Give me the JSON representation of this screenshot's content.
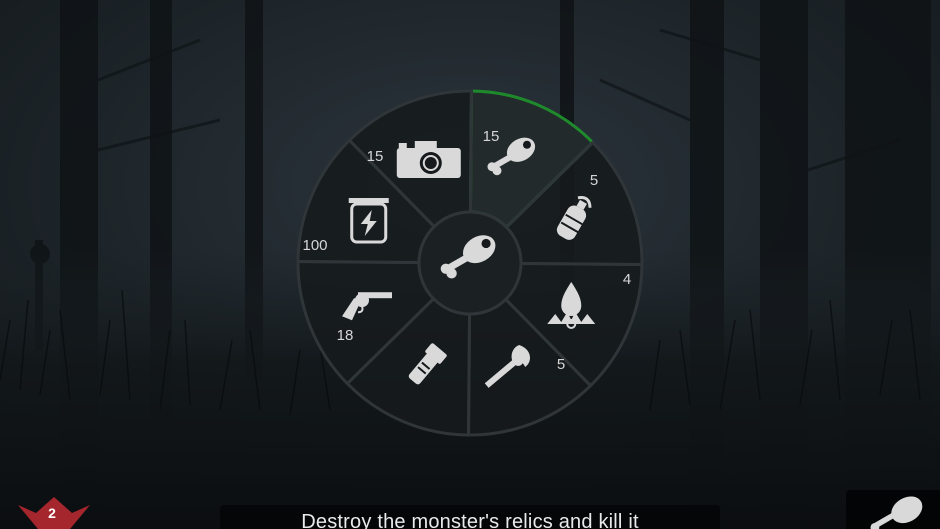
{
  "colors": {
    "sky": "#1f272d",
    "fog": "#2c363d",
    "wheel_bg": "#161a1c",
    "divider": "#2f3538",
    "selected_outline": "#1f8a2c",
    "icon": "#d9d9d9",
    "relic_red": "#a5262c"
  },
  "wheel": {
    "selected_item": "meat",
    "center_icon": "meat-icon",
    "segments": [
      {
        "item": "meat",
        "icon": "meat-icon",
        "count": "15",
        "selected": true
      },
      {
        "item": "fuel-canister",
        "icon": "fuel-canister-icon",
        "count": "5",
        "selected": false
      },
      {
        "item": "trap",
        "icon": "trap-icon",
        "count": "4",
        "selected": false
      },
      {
        "item": "torch",
        "icon": "torch-icon",
        "count": "5",
        "selected": false
      },
      {
        "item": "flashlight",
        "icon": "flashlight-icon",
        "count": "",
        "selected": false
      },
      {
        "item": "revolver",
        "icon": "revolver-icon",
        "count": "18",
        "selected": false
      },
      {
        "item": "battery",
        "icon": "battery-icon",
        "count": "100",
        "selected": false
      },
      {
        "item": "camera",
        "icon": "camera-icon",
        "count": "15",
        "selected": false
      }
    ]
  },
  "hud": {
    "objective": "Destroy the monster's relics and kill it",
    "relic_icon": "relic-icon",
    "relic_count": "2",
    "equipped_icon": "meat-icon"
  }
}
